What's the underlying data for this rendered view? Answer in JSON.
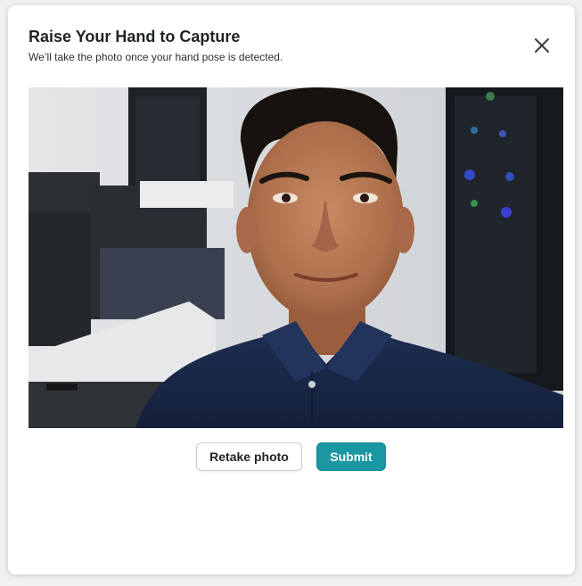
{
  "dialog": {
    "title": "Raise Your Hand to Capture",
    "subtitle": "We’ll take the photo once your hand pose is detected."
  },
  "photo": {
    "description_icon": "captured-photo"
  },
  "actions": {
    "retake_label": "Retake photo",
    "submit_label": "Submit"
  },
  "colors": {
    "accent": "#1a97a0",
    "text": "#1f2328"
  },
  "icons": {
    "close": "close-icon"
  }
}
